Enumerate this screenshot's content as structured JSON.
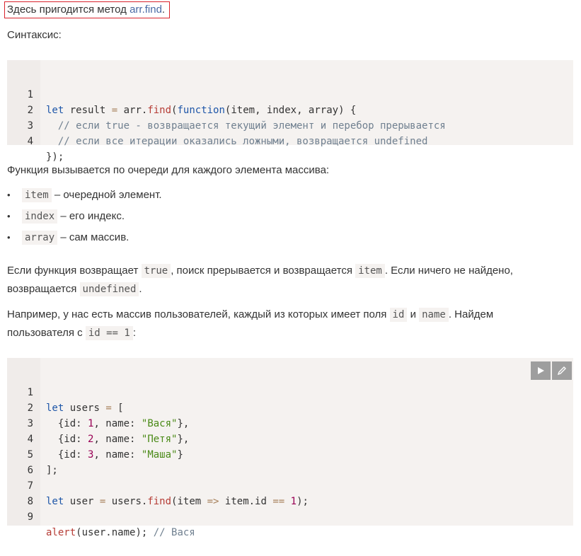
{
  "intro": {
    "text": "Здесь пригодится метод ",
    "link": "arr.find",
    "end": "."
  },
  "syntax_heading": "Синтаксис:",
  "syntax_code": {
    "line_numbers": [
      "1",
      "2",
      "3",
      "4"
    ],
    "l1": {
      "kw": "let",
      "var": " result ",
      "op": "=",
      "obj": " arr",
      "dot": ".",
      "fn": "find",
      "p1": "(",
      "kw2": "function",
      "params": "(item, index, array) {"
    },
    "l2": "  // если true - возвращается текущий элемент и перебор прерывается",
    "l3": "  // если все итерации оказались ложными, возвращается undefined",
    "l4": "});"
  },
  "desc": "Функция вызывается по очереди для каждого элемента массива:",
  "params_list": [
    {
      "code": "item",
      "text": " – очередной элемент."
    },
    {
      "code": "index",
      "text": " – его индекс."
    },
    {
      "code": "array",
      "text": " – сам массив."
    }
  ],
  "para1": {
    "t1": "Если функция возвращает ",
    "c1": "true",
    "t2": ", поиск прерывается и возвращается ",
    "c2": "item",
    "t3": ". Если ничего не найдено,",
    "t4": "возвращается ",
    "c3": "undefined",
    "t5": "."
  },
  "para2": {
    "t1": "Например, у нас есть массив пользователей, каждый из которых имеет поля ",
    "c1": "id",
    "t2": " и ",
    "c2": "name",
    "t3": ". Найдем",
    "t4": "пользователя с ",
    "c3": "id == 1",
    "t5": ":"
  },
  "example_code": {
    "line_numbers": [
      "1",
      "2",
      "3",
      "4",
      "5",
      "6",
      "7",
      "8",
      "9"
    ],
    "l1": {
      "kw": "let",
      "rest": " users ",
      "op": "=",
      "br": " ["
    },
    "rows": [
      {
        "a": "  {id: ",
        "num": "1",
        "b": ", name: ",
        "str": "\"Вася\"",
        "c": "},"
      },
      {
        "a": "  {id: ",
        "num": "2",
        "b": ", name: ",
        "str": "\"Петя\"",
        "c": "},"
      },
      {
        "a": "  {id: ",
        "num": "3",
        "b": ", name: ",
        "str": "\"Маша\"",
        "c": "}"
      }
    ],
    "l5": "];",
    "l7": {
      "kw": "let",
      "a": " user ",
      "op": "=",
      "b": " users",
      "dot": ".",
      "fn": "find",
      "c": "(item ",
      "arrow": "=>",
      "d": " item.id ",
      "eq": "==",
      "e": " ",
      "num": "1",
      "f": ");"
    },
    "l9": {
      "fn": "alert",
      "a": "(user.name); ",
      "cm": "// Вася"
    }
  },
  "toolbar": {
    "run_icon": "play-icon",
    "edit_icon": "pencil-icon"
  }
}
